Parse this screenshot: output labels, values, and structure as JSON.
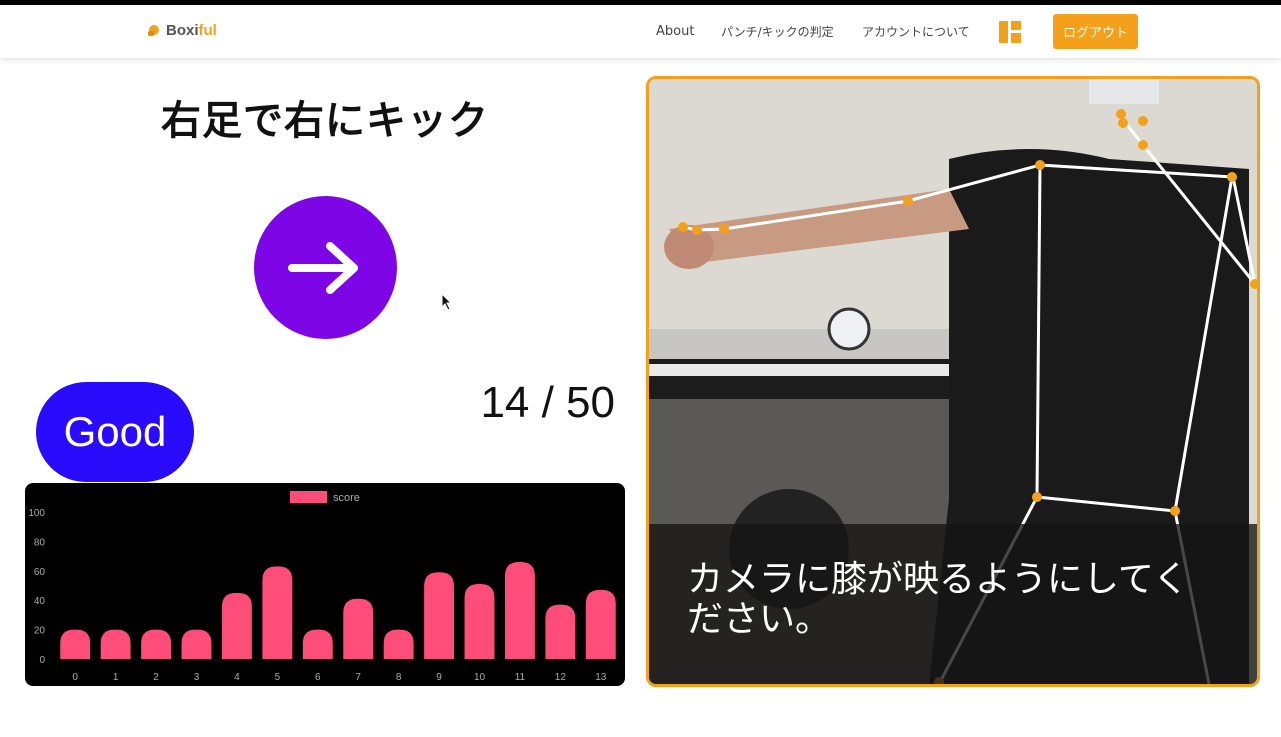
{
  "brand": {
    "prefix": "Boxi",
    "accent": "ful",
    "icon": "boxing-glove-icon"
  },
  "nav": {
    "about": "About",
    "judge": "パンチ/キックの判定",
    "account": "アカウントについて",
    "grid_icon": "layout-grid-icon",
    "logout": "ログアウト"
  },
  "colors": {
    "accent": "#f5a01a",
    "arrow_bg": "#7d05e6",
    "good_bg": "#2a0bfb",
    "bar": "#ff4d7a"
  },
  "instruction": "右足で右にキック",
  "arrow_icon": "arrow-right-icon",
  "good_label": "Good",
  "counter": "14 / 50",
  "caption": "カメラに膝が映るようにしてください。",
  "chart_data": {
    "type": "bar",
    "categories": [
      "0",
      "1",
      "2",
      "3",
      "4",
      "5",
      "6",
      "7",
      "8",
      "9",
      "10",
      "11",
      "12",
      "13"
    ],
    "series": [
      {
        "name": "score",
        "values": [
          20,
          20,
          20,
          20,
          45,
          63,
          20,
          41,
          20,
          59,
          51,
          66,
          37,
          47
        ]
      }
    ],
    "ylim": [
      0,
      100
    ],
    "yticks": [
      0,
      20,
      40,
      60,
      80,
      100
    ],
    "legend": "top",
    "grid": false
  }
}
